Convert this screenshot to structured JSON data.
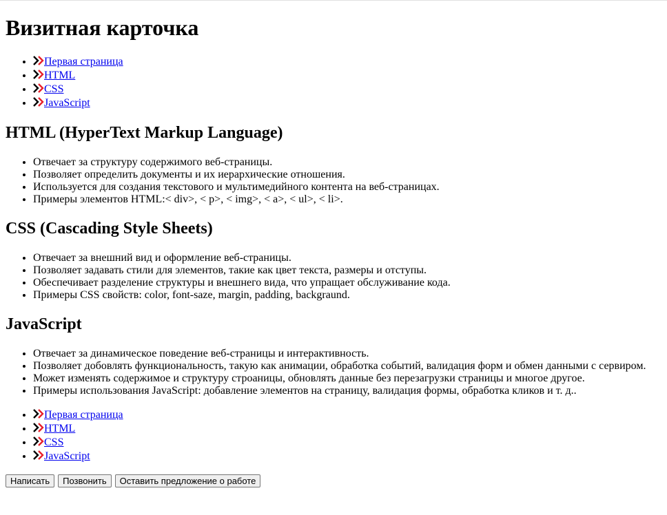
{
  "title": "Визитная карточка",
  "nav": [
    "Первая страница",
    "HTML",
    "CSS",
    "JavaScript"
  ],
  "sections": [
    {
      "heading": "HTML (HyperText Markup Language)",
      "items": [
        "Отвечает за структуру содержимого веб-страницы.",
        "Позволяет определить документы и их иерархические отношения.",
        "Используется для создания текстового и мультимедийного контента на веб-страницах.",
        "Примеры элементов HTML:< div>, < p>, < img>, < a>, < ul>, < li>."
      ]
    },
    {
      "heading": "CSS (Cascading Style Sheets)",
      "items": [
        "Отвечает за внешний вид и оформление веб-страницы.",
        "Позволяет задавать стили для элементов, такие как цвет текста, размеры и отступы.",
        "Обеспечивает разделение структуры и внешнего вида, что упращает обслуживание кода.",
        "Примеры CSS свойств: color, font-saze, margin, padding, backgraund."
      ]
    },
    {
      "heading": "JavaScript",
      "items": [
        "Отвечает за динамическое поведение веб-страницы и интерактивность.",
        "Позволяет добовлять функциональность, такую как анимации, обработка событий, валидация форм и обмен данными с сервиром.",
        "Может изменять содержимое и структуру строаницы, обновлять данные без перезагрузки страницы и многое другое.",
        "Примеры использования JavaScript: добавление элементов на страницу, валидация формы, обработка кликов и т. д.."
      ]
    }
  ],
  "buttons": [
    "Написать",
    "Позвонить",
    "Оставить предложение о работе"
  ],
  "colors": {
    "icon_red": "#e8202a",
    "link": "#0000ee"
  }
}
